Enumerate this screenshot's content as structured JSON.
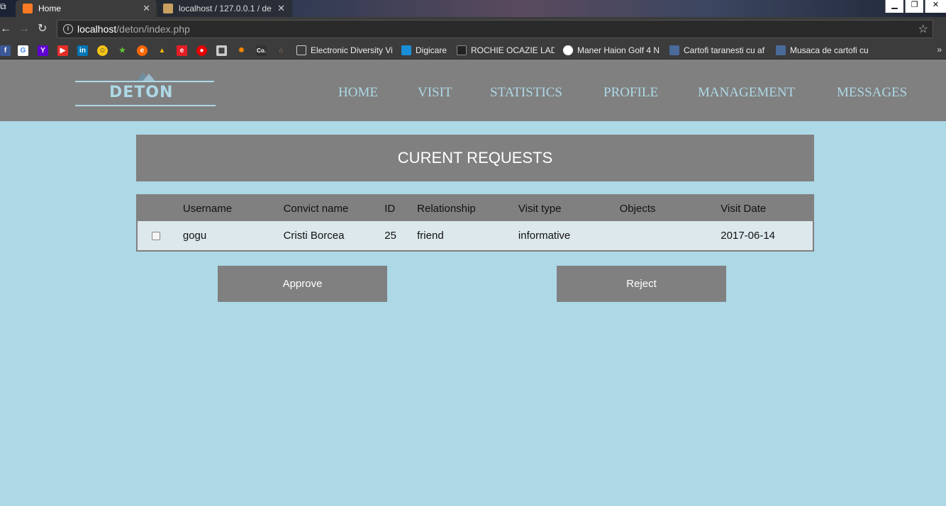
{
  "browser": {
    "tabs": [
      {
        "label": "Home",
        "active": true
      },
      {
        "label": "localhost / 127.0.0.1 / de",
        "active": false
      }
    ],
    "url_host": "localhost",
    "url_path": "/deton/index.php",
    "bookmarks": [
      {
        "label": "Electronic Diversity Vi"
      },
      {
        "label": "Digicare"
      },
      {
        "label": "ROCHIE OCAZIE LADY"
      },
      {
        "label": "Maner Haion Golf 4 N"
      },
      {
        "label": "Cartofi taranesti cu af"
      },
      {
        "label": "Musaca de cartofi cu"
      }
    ],
    "bookmark_icon_names": [
      "facebook-icon",
      "google-icon",
      "yahoo-icon",
      "youtube-icon",
      "linkedin-icon",
      "emoji-icon",
      "star-icon",
      "orange-icon",
      "drive-icon",
      "e-icon",
      "vodafone-icon",
      "doc-icon",
      "gear-icon",
      "co-icon",
      "house-icon"
    ]
  },
  "site": {
    "logo_text": "DETON",
    "nav": [
      "HOME",
      "VISIT",
      "STATISTICS",
      "PROFILE",
      "MANAGEMENT",
      "MESSAGES"
    ]
  },
  "main": {
    "title": "CURENT REQUESTS",
    "table": {
      "headers": [
        "Username",
        "Convict name",
        "ID",
        "Relationship",
        "Visit type",
        "Objects",
        "Visit Date"
      ],
      "rows": [
        {
          "username": "gogu",
          "convict_name": "Cristi Borcea",
          "id": "25",
          "relationship": "friend",
          "visit_type": "informative",
          "objects": "",
          "visit_date": "2017-06-14"
        }
      ]
    },
    "approve_label": "Approve",
    "reject_label": "Reject"
  },
  "colors": {
    "page_bg": "#add8e6",
    "panel_gray": "#808080",
    "row_bg": "#dde8ec",
    "accent": "#add8e6"
  }
}
